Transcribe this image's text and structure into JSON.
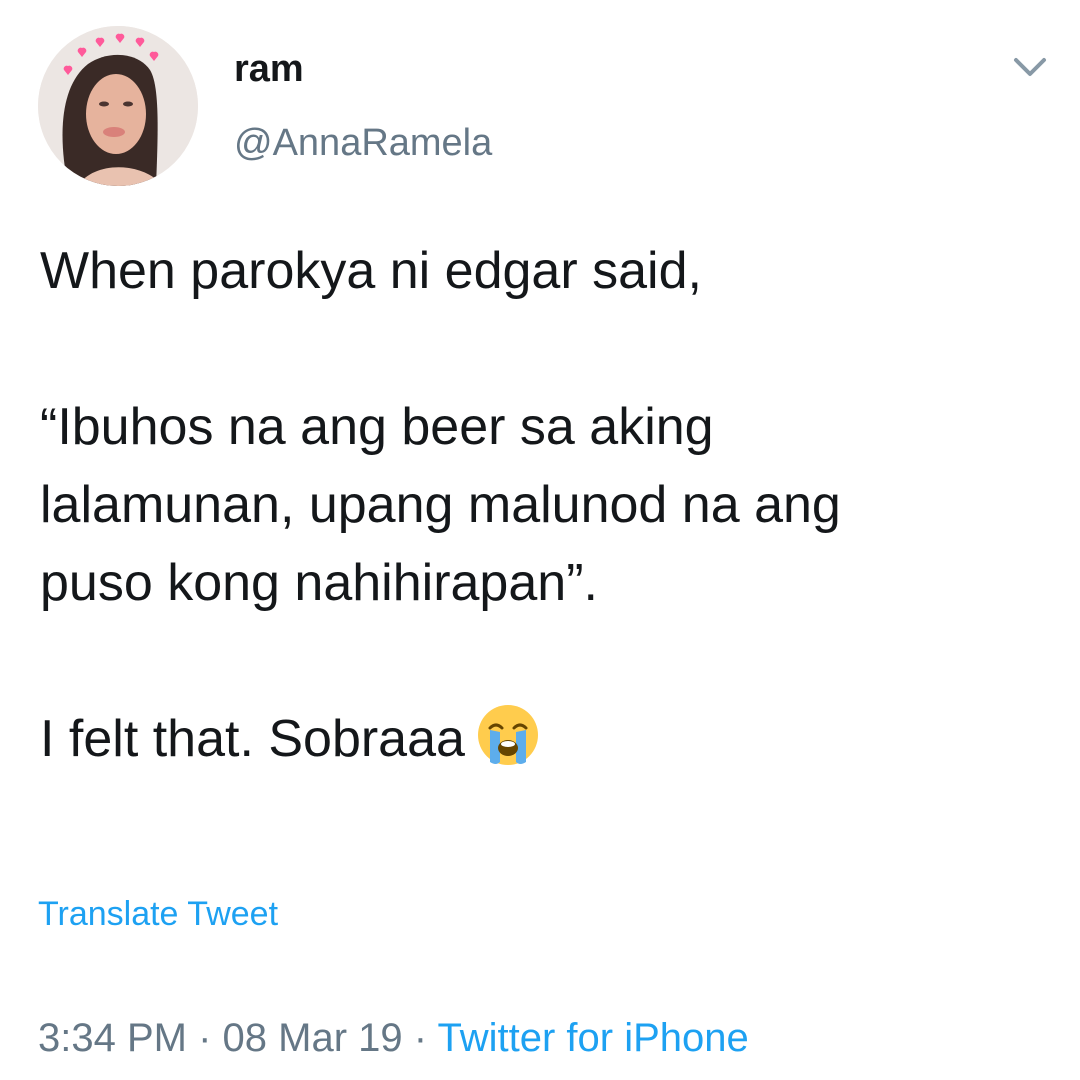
{
  "author": {
    "display_name": "ram",
    "handle": "@AnnaRamela"
  },
  "tweet": {
    "line1": "When parokya ni edgar said,",
    "quote_line1": "“Ibuhos na ang beer sa aking",
    "quote_line2": "lalamunan, upang malunod na ang",
    "quote_line3": "puso kong nahihirapan”.",
    "closing_text": "I felt that. Sobraaa",
    "emoji": "loudly-crying-face-emoji"
  },
  "translate_label": "Translate Tweet",
  "meta": {
    "time": "3:34 PM",
    "separator": "·",
    "date": "08 Mar 19",
    "source": "Twitter for iPhone"
  },
  "icons": {
    "menu": "chevron-down-icon"
  },
  "colors": {
    "text": "#14171a",
    "secondary": "#657786",
    "link": "#1da1f2",
    "background": "#ffffff"
  }
}
